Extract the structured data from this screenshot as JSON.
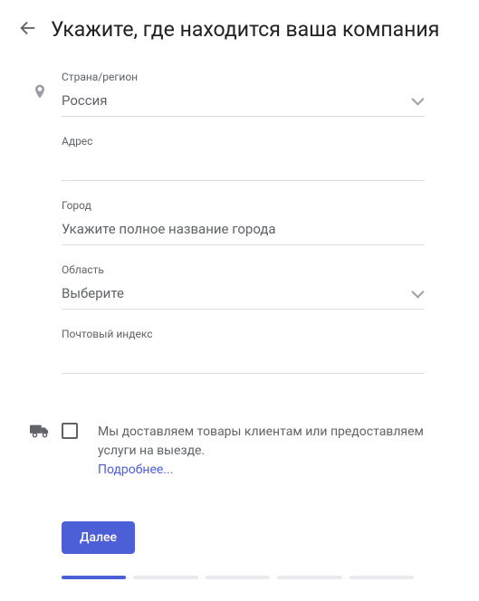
{
  "header": {
    "title": "Укажите, где находится ваша компания"
  },
  "form": {
    "country": {
      "label": "Страна/регион",
      "value": "Россия"
    },
    "address": {
      "label": "Адрес",
      "value": ""
    },
    "city": {
      "label": "Город",
      "placeholder": "Укажите полное название города",
      "value": ""
    },
    "region": {
      "label": "Область",
      "value": "Выберите"
    },
    "postal": {
      "label": "Почтовый индекс",
      "value": ""
    }
  },
  "delivery": {
    "text": "Мы доставляем товары клиентам или предоставляем услуги на выезде.",
    "learn_more": "Подробнее..."
  },
  "buttons": {
    "next": "Далее"
  },
  "progress": {
    "total": 5,
    "current": 1
  },
  "icons": {
    "back": "arrow-left",
    "location": "location-pin",
    "delivery": "truck"
  }
}
